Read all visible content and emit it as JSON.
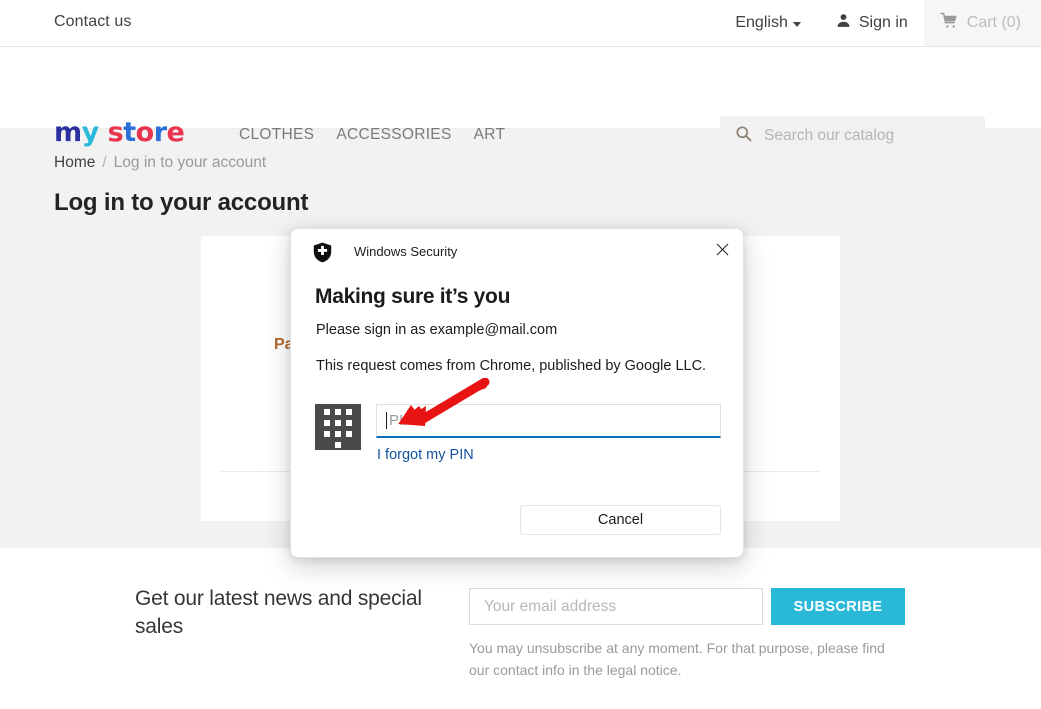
{
  "topbar": {
    "contact_label": "Contact us",
    "language": "English",
    "signin_label": "Sign in",
    "cart_label": "Cart (0)",
    "person_icon": "person-icon",
    "cart_icon": "shopping-cart-icon",
    "caret_icon": "chevron-down-icon"
  },
  "header": {
    "logo": {
      "letters": [
        {
          "ch": "m",
          "color": "#2b2fa0"
        },
        {
          "ch": "y",
          "color": "#29b8d8"
        },
        {
          "ch": " ",
          "color": "#ffffff"
        },
        {
          "ch": "s",
          "color": "#e8344e"
        },
        {
          "ch": "t",
          "color": "#2b6fd8"
        },
        {
          "ch": "o",
          "color": "#e8344e"
        },
        {
          "ch": "r",
          "color": "#2b6fd8"
        },
        {
          "ch": "e",
          "color": "#e8344e"
        }
      ],
      "text": "my store"
    },
    "nav": [
      {
        "label": "CLOTHES"
      },
      {
        "label": "ACCESSORIES"
      },
      {
        "label": "ART"
      }
    ],
    "search": {
      "placeholder": "Search our catalog",
      "value": "",
      "icon": "search-icon"
    }
  },
  "breadcrumb": {
    "home": "Home",
    "separator": "/",
    "current": "Log in to your account"
  },
  "page": {
    "title": "Log in to your account"
  },
  "login_card": {
    "password_label": "Pa"
  },
  "newsletter": {
    "heading": "Get our latest news and special sales",
    "email_placeholder": "Your email address",
    "email_value": "",
    "subscribe_label": "SUBSCRIBE",
    "note": "You may unsubscribe at any moment. For that purpose, please find our contact info in the legal notice.",
    "accent_color": "#29b8d8"
  },
  "windows_dialog": {
    "shield_icon": "shield-icon",
    "title": "Windows Security",
    "close_icon": "close-icon",
    "heading": "Making sure it’s you",
    "line1": "Please sign in as example@mail.com",
    "line2": "This request comes from Chrome, published by Google LLC.",
    "keypad_icon": "pin-keypad-icon",
    "pin_placeholder": "PIN",
    "pin_value": "",
    "forgot_link": "I forgot my PIN",
    "cancel_label": "Cancel",
    "underline_color": "#0b6fba",
    "link_color": "#12539e"
  },
  "annotation": {
    "arrow_color": "#e81313",
    "arrow_name": "red-pointer-arrow"
  }
}
